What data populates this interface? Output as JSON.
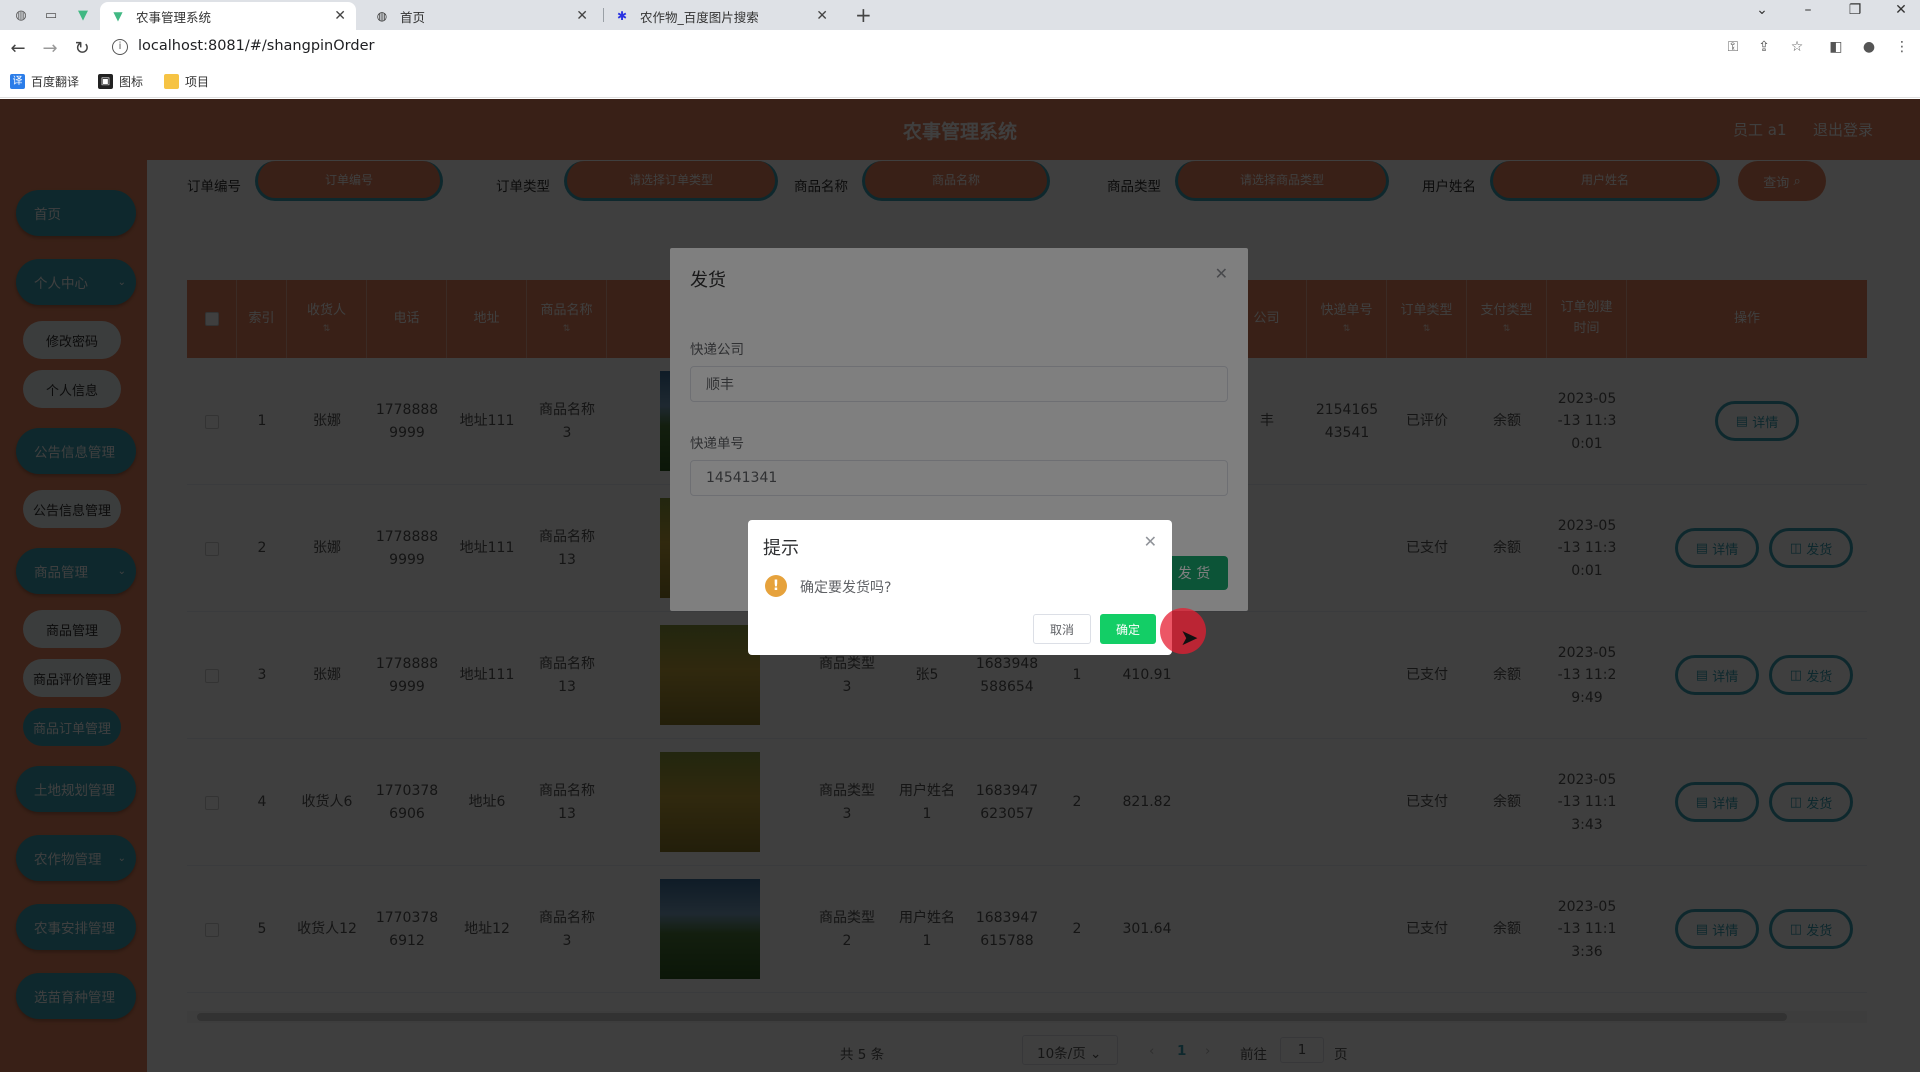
{
  "browser": {
    "tabs": [
      {
        "title": "农事管理系统",
        "icon": "vue-logo-icon",
        "active": true
      },
      {
        "title": "首页",
        "icon": "globe-icon",
        "active": false
      },
      {
        "title": "农作物_百度图片搜索",
        "icon": "baidu-paw-icon",
        "active": false
      }
    ],
    "url": "localhost:8081/#/shangpinOrder",
    "bookmarks": [
      {
        "label": "百度翻译",
        "icon": "translate-icon"
      },
      {
        "label": "图标",
        "icon": "image-icon"
      },
      {
        "label": "项目",
        "icon": "folder-icon"
      }
    ]
  },
  "header": {
    "title": "农事管理系统",
    "user": "员工 a1",
    "logout": "退出登录"
  },
  "sidebar": {
    "home": "首页",
    "personal": "个人中心",
    "change_password": "修改密码",
    "personal_info": "个人信息",
    "notice_mgmt": "公告信息管理",
    "notice_sub": "公告信息管理",
    "goods_mgmt": "商品管理",
    "goods_sub": "商品管理",
    "goods_review": "商品评价管理",
    "goods_order": "商品订单管理",
    "land_plan": "土地规划管理",
    "crop_mgmt": "农作物管理",
    "farm_schedule": "农事安排管理",
    "seed_mgmt": "选苗育种管理"
  },
  "filters": {
    "order_no_label": "订单编号",
    "order_no_placeholder": "订单编号",
    "order_type_label": "订单类型",
    "order_type_placeholder": "请选择订单类型",
    "goods_name_label": "商品名称",
    "goods_name_placeholder": "商品名称",
    "goods_type_label": "商品类型",
    "goods_type_placeholder": "请选择商品类型",
    "user_name_label": "用户姓名",
    "user_name_placeholder": "用户姓名",
    "search": "查询"
  },
  "table": {
    "columns": {
      "index": "索引",
      "receiver": "收货人",
      "phone": "电话",
      "address": "地址",
      "goods_name": "商品名称",
      "courier": "公司",
      "tracking": "快递单号",
      "order_type": "订单类型",
      "pay_type": "支付类型",
      "created": "订单创建\n时间",
      "ops": "操作"
    },
    "rows": [
      {
        "index": "1",
        "receiver": "张娜",
        "phone": "1778888\n9999",
        "address": "地址111",
        "goods_name": "商品名称\n3",
        "goods_type": "",
        "user": "",
        "order_no": "",
        "qty": "",
        "amount": "",
        "courier": "丰",
        "tracking": "2154165\n43541",
        "order_type": "已评价",
        "pay_type": "余额",
        "created": "2023-05\n-13 11:3\n0:01",
        "detail": "详情",
        "ship": ""
      },
      {
        "index": "2",
        "receiver": "张娜",
        "phone": "1778888\n9999",
        "address": "地址111",
        "goods_name": "商品名称\n13",
        "goods_type": "",
        "user": "",
        "order_no": "",
        "qty": "",
        "amount": "",
        "courier": "",
        "tracking": "",
        "order_type": "已支付",
        "pay_type": "余额",
        "created": "2023-05\n-13 11:3\n0:01",
        "detail": "详情",
        "ship": "发货"
      },
      {
        "index": "3",
        "receiver": "张娜",
        "phone": "1778888\n9999",
        "address": "地址111",
        "goods_name": "商品名称\n13",
        "goods_type": "商品类型\n3",
        "user": "张5",
        "order_no": "1683948\n588654",
        "qty": "1",
        "amount": "410.91",
        "courier": "",
        "tracking": "",
        "order_type": "已支付",
        "pay_type": "余额",
        "created": "2023-05\n-13 11:2\n9:49",
        "detail": "详情",
        "ship": "发货"
      },
      {
        "index": "4",
        "receiver": "收货人6",
        "phone": "1770378\n6906",
        "address": "地址6",
        "goods_name": "商品名称\n13",
        "goods_type": "商品类型\n3",
        "user": "用户姓名\n1",
        "order_no": "1683947\n623057",
        "qty": "2",
        "amount": "821.82",
        "courier": "",
        "tracking": "",
        "order_type": "已支付",
        "pay_type": "余额",
        "created": "2023-05\n-13 11:1\n3:43",
        "detail": "详情",
        "ship": "发货"
      },
      {
        "index": "5",
        "receiver": "收货人12",
        "phone": "1770378\n6912",
        "address": "地址12",
        "goods_name": "商品名称\n3",
        "goods_type": "商品类型\n2",
        "user": "用户姓名\n1",
        "order_no": "1683947\n615788",
        "qty": "2",
        "amount": "301.64",
        "courier": "",
        "tracking": "",
        "order_type": "已支付",
        "pay_type": "余额",
        "created": "2023-05\n-13 11:1\n3:36",
        "detail": "详情",
        "ship": "发货"
      }
    ]
  },
  "pagination": {
    "total": "共 5 条",
    "page_size": "10条/页",
    "current": "1",
    "goto_label": "前往",
    "goto_value": "1",
    "page_suffix": "页"
  },
  "ship_dialog": {
    "title": "发货",
    "courier_label": "快递公司",
    "courier_value": "顺丰",
    "tracking_label": "快递单号",
    "tracking_value": "14541341",
    "submit": "发 货"
  },
  "confirm_dialog": {
    "title": "提示",
    "message": "确定要发货吗?",
    "cancel": "取消",
    "ok": "确定"
  },
  "colors": {
    "accent_orange": "#e4825c",
    "accent_teal": "#39a2b6",
    "confirm_green": "#13ce66",
    "warning": "#e6a23c"
  }
}
